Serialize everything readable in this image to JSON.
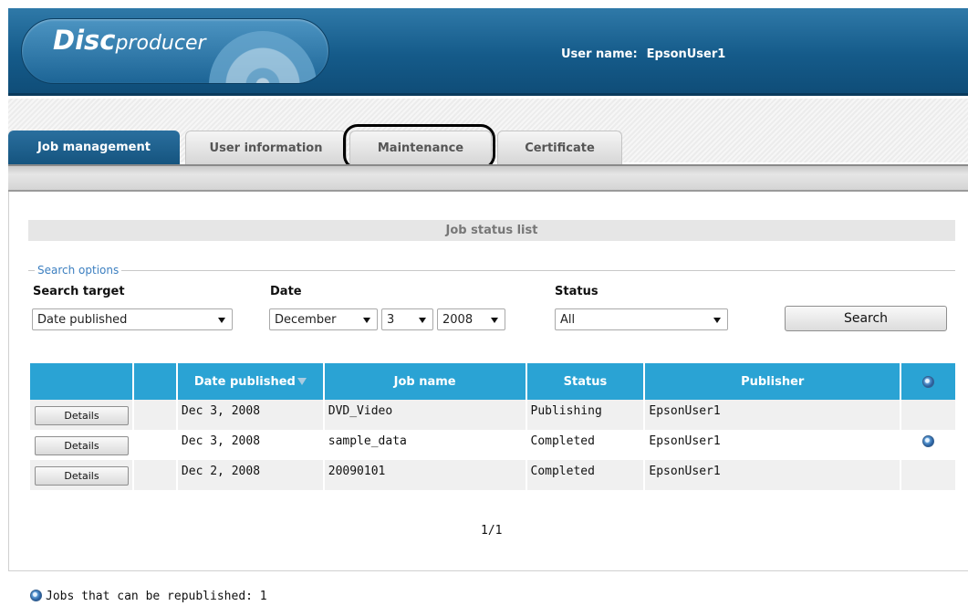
{
  "header": {
    "logo_disc": "Disc",
    "logo_producer": "producer",
    "user_label": "User name:",
    "user_name": "EpsonUser1"
  },
  "tabs": [
    {
      "label": "Job management",
      "active": true
    },
    {
      "label": "User information",
      "active": false
    },
    {
      "label": "Maintenance",
      "active": false,
      "highlighted": true
    },
    {
      "label": "Certificate",
      "active": false
    }
  ],
  "job_list": {
    "title": "Job status list",
    "search_options": {
      "legend": "Search options",
      "target_label": "Search target",
      "target_value": "Date published",
      "date_label": "Date",
      "month_value": "December",
      "day_value": "3",
      "year_value": "2008",
      "status_label": "Status",
      "status_value": "All",
      "search_button": "Search"
    },
    "columns": [
      "",
      "",
      "Date published",
      "Job name",
      "Status",
      "Publisher",
      "republish-icon"
    ],
    "rows": [
      {
        "details": "Details",
        "date": "Dec 3, 2008",
        "job": "DVD_Video",
        "status": "Publishing",
        "publisher": "EpsonUser1",
        "republishable": false
      },
      {
        "details": "Details",
        "date": "Dec 3, 2008",
        "job": "sample_data",
        "status": "Completed",
        "publisher": "EpsonUser1",
        "republishable": true
      },
      {
        "details": "Details",
        "date": "Dec 2, 2008",
        "job": "20090101",
        "status": "Completed",
        "publisher": "EpsonUser1",
        "republishable": false
      }
    ],
    "pager": "1/1"
  },
  "footer": {
    "note": "Jobs that can be republished: 1"
  },
  "colors": {
    "header_blue": "#155b8a",
    "table_header": "#2aa3d4",
    "legend_blue": "#3c7fc0"
  }
}
